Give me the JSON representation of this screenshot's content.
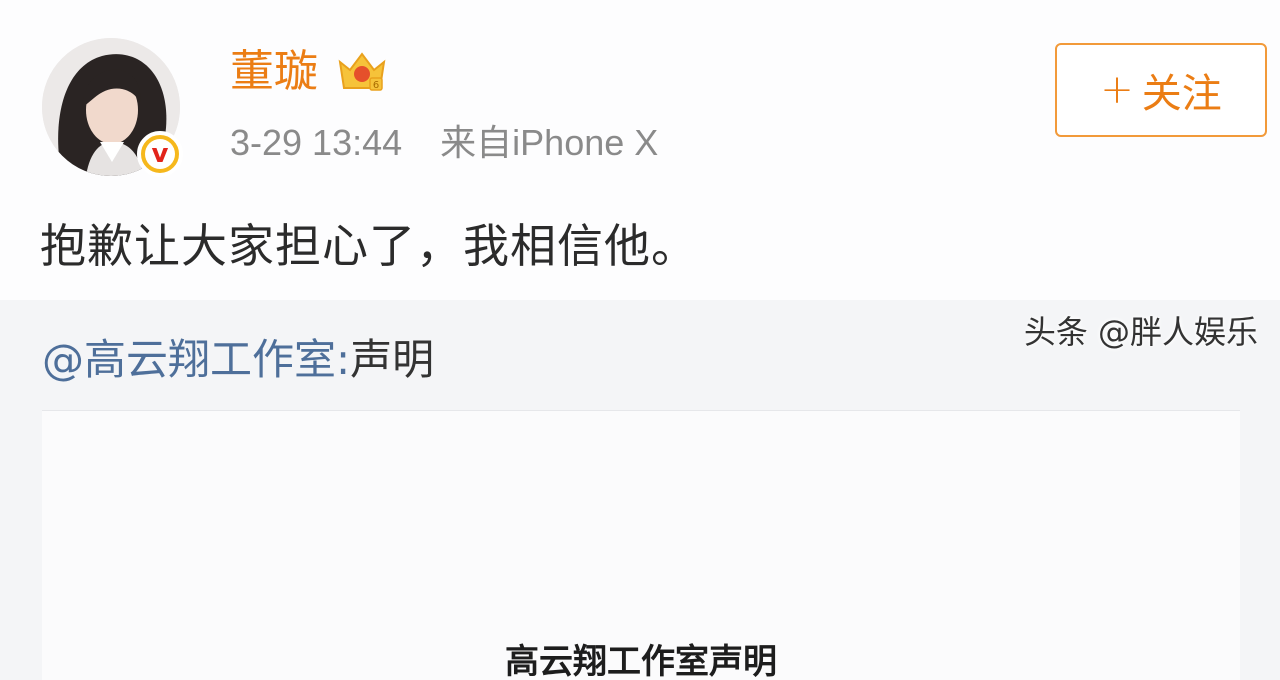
{
  "header": {
    "username": "董璇",
    "vip_icon": "crown-vip-icon",
    "verified_icon": "v",
    "timestamp": "3-29 13:44",
    "source": "来自iPhone X",
    "follow_button": {
      "plus": "+",
      "label": "关注"
    }
  },
  "post": {
    "text": "抱歉让大家担心了，我相信他。"
  },
  "repost": {
    "mention": "@高云翔工作室",
    "colon": ":",
    "title": "声明",
    "image_title": "高云翔工作室声明"
  },
  "watermark": "头条 @胖人娱乐",
  "colors": {
    "accent": "#eb7d14",
    "link": "#4e6f9a",
    "verified": "#f6b81c"
  }
}
